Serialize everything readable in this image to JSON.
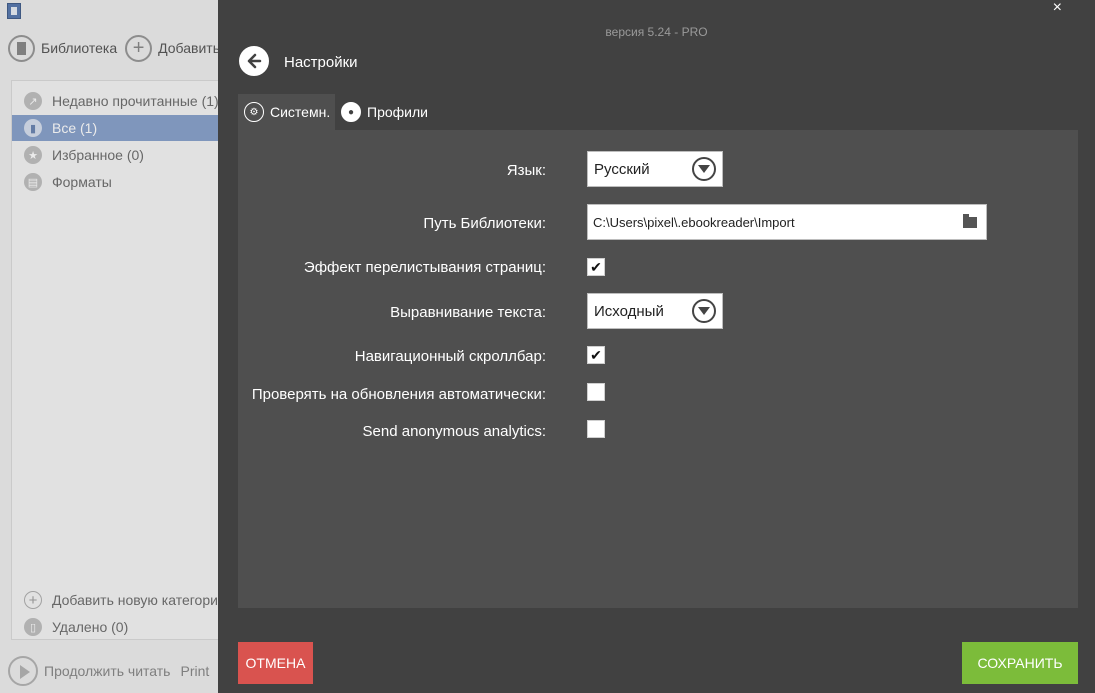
{
  "background_app": {
    "toolbar": {
      "library_label": "Библиотека",
      "add_label": "Добавить"
    },
    "sidebar": {
      "items": [
        {
          "label": "Недавно прочитанные (1)",
          "icon": "share-icon"
        },
        {
          "label": "Все (1)",
          "icon": "book-icon",
          "active": true
        },
        {
          "label": "Избранное (0)",
          "icon": "star-icon"
        },
        {
          "label": "Форматы",
          "icon": "document-icon"
        }
      ],
      "add_category_label": "Добавить новую категори",
      "deleted_label": "Удалено (0)"
    },
    "footer": {
      "continue_label": "Продолжить читать",
      "print_label": "Print"
    }
  },
  "dialog": {
    "version": "версия 5.24 - PRO",
    "close_label": "×",
    "title": "Настройки",
    "tabs": [
      {
        "label": "Системн.",
        "icon": "gears-icon",
        "active": true
      },
      {
        "label": "Профили",
        "icon": "user-icon",
        "active": false
      }
    ],
    "settings": {
      "language_label": "Язык:",
      "language_value": "Русский",
      "library_path_label": "Путь Библиотеки:",
      "library_path_value": "C:\\Users\\pixel\\.ebookreader\\Import",
      "page_flip_label": "Эффект перелистывания страниц:",
      "page_flip_checked": true,
      "text_align_label": "Выравнивание текста:",
      "text_align_value": "Исходный",
      "nav_scrollbar_label": "Навигационный скроллбар:",
      "nav_scrollbar_checked": true,
      "auto_update_label": "Проверять на обновления автоматически:",
      "auto_update_checked": false,
      "analytics_label": "Send anonymous analytics:",
      "analytics_checked": false
    },
    "check_mark": "✔",
    "buttons": {
      "cancel_label": "ОТМЕНА",
      "save_label": "СОХРАНИТЬ"
    }
  },
  "colors": {
    "dialog_bg": "#414141",
    "panel_bg": "#4f4f4f",
    "cancel": "#d9534f",
    "save": "#7cbc3a",
    "sidebar_active": "#8aa3cc"
  }
}
